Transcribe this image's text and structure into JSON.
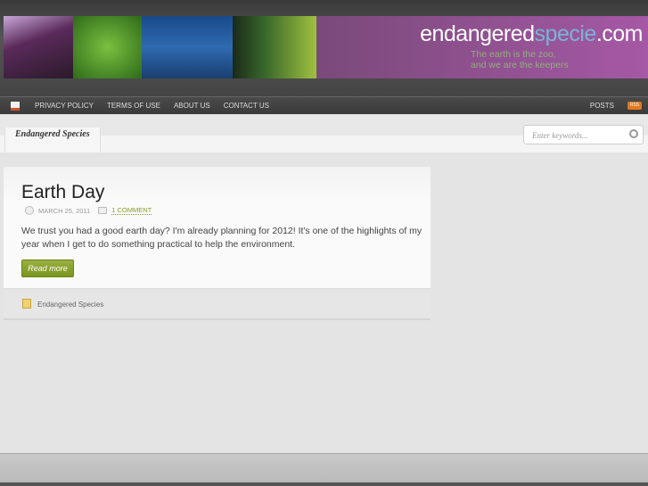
{
  "site": {
    "name_main": "endangered",
    "name_accent": "specie",
    "name_tld": ".com",
    "tagline_1": "The earth is the zoo,",
    "tagline_2": "and we are the keepers"
  },
  "nav": {
    "items": [
      "PRIVACY POLICY",
      "TERMS OF USE",
      "ABOUT US",
      "CONTACT US"
    ],
    "posts": "POSTS",
    "rss": "RSS"
  },
  "tab": "Endangered Species",
  "search": {
    "placeholder": "Enter keywords..."
  },
  "post": {
    "title": "Earth Day",
    "date": "MARCH 25, 2011",
    "comments": "1 COMMENT",
    "excerpt": "We trust you had a good earth day? I'm already planning for 2012! It's one of the highlights of my year when I get to do something practical to help the environment.",
    "read_more": "Read more",
    "category": "Endangered Species"
  }
}
